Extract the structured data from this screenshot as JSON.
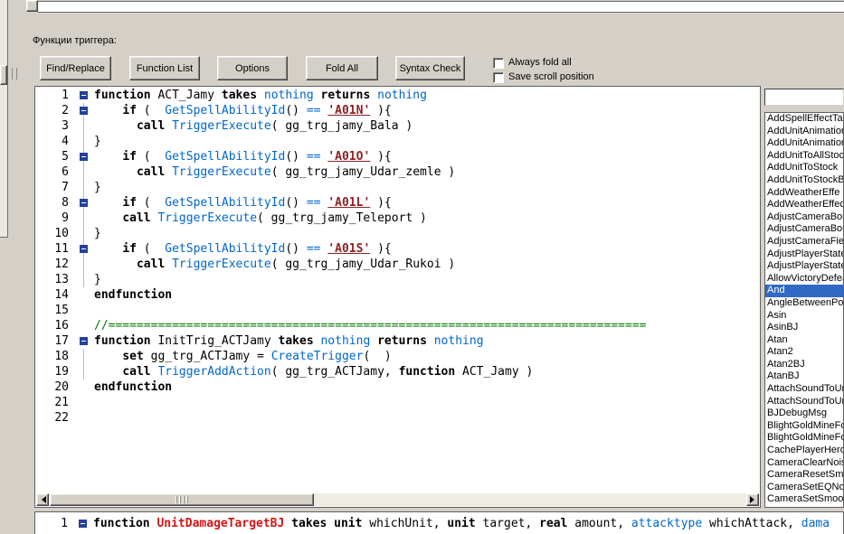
{
  "panel": {
    "label": "Функции триггера:"
  },
  "toolbar": {
    "buttons": [
      "Find/Replace",
      "Function List",
      "Options",
      "Fold All",
      "Syntax Check"
    ],
    "checkboxes": [
      {
        "label": "Always fold all",
        "checked": false
      },
      {
        "label": "Save scroll position",
        "checked": false
      }
    ]
  },
  "colors": {
    "window_bg": "#d4d0c8",
    "selection": "#316ac5",
    "keyword": "#000000",
    "native_blue": "#0066cc",
    "rawcode_red": "#8b2323",
    "comment_green": "#007800",
    "function_name_red": "#d41414",
    "fold_marker_blue": "#24409a"
  },
  "editor": {
    "lines": [
      {
        "num": "1",
        "fold": true,
        "segs": [
          [
            "k",
            "function "
          ],
          [
            "p",
            "ACT_Jamy "
          ],
          [
            "k",
            "takes "
          ],
          [
            "t",
            "nothing "
          ],
          [
            "k",
            "returns "
          ],
          [
            "t",
            "nothing"
          ]
        ]
      },
      {
        "num": "2",
        "fold": true,
        "fl": true,
        "segs": [
          [
            "p",
            "    "
          ],
          [
            "k",
            "if "
          ],
          [
            "p",
            "(  "
          ],
          [
            "n",
            "GetSpellAbilityId"
          ],
          [
            "p",
            "() "
          ],
          [
            "n",
            "== "
          ],
          [
            "r",
            "'A01N'"
          ],
          [
            "p",
            " ){"
          ]
        ]
      },
      {
        "num": "3",
        "fl": true,
        "segs": [
          [
            "p",
            "      "
          ],
          [
            "k",
            "call "
          ],
          [
            "n",
            "TriggerExecute"
          ],
          [
            "p",
            "( gg_trg_jamy_Bala )"
          ]
        ]
      },
      {
        "num": "4",
        "fl": true,
        "segs": [
          [
            "p",
            "}"
          ]
        ]
      },
      {
        "num": "5",
        "fold": true,
        "fl": true,
        "segs": [
          [
            "p",
            "    "
          ],
          [
            "k",
            "if "
          ],
          [
            "p",
            "(  "
          ],
          [
            "n",
            "GetSpellAbilityId"
          ],
          [
            "p",
            "() "
          ],
          [
            "n",
            "== "
          ],
          [
            "r",
            "'A01O'"
          ],
          [
            "p",
            " ){"
          ]
        ]
      },
      {
        "num": "6",
        "fl": true,
        "segs": [
          [
            "p",
            "      "
          ],
          [
            "k",
            "call "
          ],
          [
            "n",
            "TriggerExecute"
          ],
          [
            "p",
            "( gg_trg_jamy_Udar_zemle )"
          ]
        ]
      },
      {
        "num": "7",
        "fl": true,
        "segs": [
          [
            "p",
            "}"
          ]
        ]
      },
      {
        "num": "8",
        "fold": true,
        "fl": true,
        "segs": [
          [
            "p",
            "    "
          ],
          [
            "k",
            "if "
          ],
          [
            "p",
            "(  "
          ],
          [
            "n",
            "GetSpellAbilityId"
          ],
          [
            "p",
            "() "
          ],
          [
            "n",
            "== "
          ],
          [
            "r",
            "'A01L'"
          ],
          [
            "p",
            " ){"
          ]
        ]
      },
      {
        "num": "9",
        "fl": true,
        "segs": [
          [
            "p",
            "    "
          ],
          [
            "k",
            "call "
          ],
          [
            "n",
            "TriggerExecute"
          ],
          [
            "p",
            "( gg_trg_jamy_Teleport )"
          ]
        ]
      },
      {
        "num": "10",
        "fl": true,
        "segs": [
          [
            "p",
            "}"
          ]
        ]
      },
      {
        "num": "11",
        "fold": true,
        "fl": true,
        "segs": [
          [
            "p",
            "    "
          ],
          [
            "k",
            "if "
          ],
          [
            "p",
            "(  "
          ],
          [
            "n",
            "GetSpellAbilityId"
          ],
          [
            "p",
            "() "
          ],
          [
            "n",
            "== "
          ],
          [
            "r",
            "'A01S'"
          ],
          [
            "p",
            " ){"
          ]
        ]
      },
      {
        "num": "12",
        "fl": true,
        "segs": [
          [
            "p",
            "      "
          ],
          [
            "k",
            "call "
          ],
          [
            "n",
            "TriggerExecute"
          ],
          [
            "p",
            "( gg_trg_jamy_Udar_Rukoi )"
          ]
        ]
      },
      {
        "num": "13",
        "fl": true,
        "segs": [
          [
            "p",
            "}"
          ]
        ]
      },
      {
        "num": "14",
        "segs": [
          [
            "k",
            "endfunction"
          ]
        ]
      },
      {
        "num": "15",
        "segs": []
      },
      {
        "num": "16",
        "segs": [
          [
            "c",
            "//============================================================================"
          ]
        ]
      },
      {
        "num": "17",
        "fold": true,
        "segs": [
          [
            "k",
            "function "
          ],
          [
            "p",
            "InitTrig_ACTJamy "
          ],
          [
            "k",
            "takes "
          ],
          [
            "t",
            "nothing "
          ],
          [
            "k",
            "returns "
          ],
          [
            "t",
            "nothing"
          ]
        ]
      },
      {
        "num": "18",
        "fl": true,
        "segs": [
          [
            "p",
            "    "
          ],
          [
            "k",
            "set "
          ],
          [
            "p",
            "gg_trg_ACTJamy = "
          ],
          [
            "n",
            "CreateTrigger"
          ],
          [
            "p",
            "(  )"
          ]
        ]
      },
      {
        "num": "19",
        "fl": true,
        "segs": [
          [
            "p",
            "    "
          ],
          [
            "k",
            "call "
          ],
          [
            "n",
            "TriggerAddAction"
          ],
          [
            "p",
            "( gg_trg_ACTJamy, "
          ],
          [
            "k",
            "function "
          ],
          [
            "p",
            "ACT_Jamy )"
          ]
        ]
      },
      {
        "num": "20",
        "segs": [
          [
            "k",
            "endfunction"
          ]
        ]
      },
      {
        "num": "21",
        "segs": []
      },
      {
        "num": "22",
        "segs": []
      }
    ]
  },
  "bottom_editor": {
    "lines": [
      {
        "num": "1",
        "fold": true,
        "segs": [
          [
            "k",
            "function "
          ],
          [
            "f",
            "UnitDamageTargetBJ"
          ],
          [
            "k",
            " takes "
          ],
          [
            "k",
            "unit"
          ],
          [
            "p",
            " whichUnit, "
          ],
          [
            "k",
            "unit"
          ],
          [
            "p",
            " target, "
          ],
          [
            "k",
            "real"
          ],
          [
            "p",
            " amount, "
          ],
          [
            "t",
            "attacktype"
          ],
          [
            "p",
            " whichAttack, "
          ],
          [
            "t",
            "dama"
          ]
        ]
      }
    ]
  },
  "sidebar": {
    "search_value": "",
    "selected_index": 14,
    "selected_item": "And",
    "items": [
      "AddSpellEffectTar",
      "AddUnitAnimatior",
      "AddUnitAnimatior",
      "AddUnitToAllStoc",
      "AddUnitToStock",
      "AddUnitToStockB",
      "AddWeatherEffe",
      "AddWeatherEffec",
      "AdjustCameraBou",
      "AdjustCameraBou",
      "AdjustCameraFiel",
      "AdjustPlayerState",
      "AdjustPlayerState",
      "AllowVictoryDefea",
      "And",
      "AngleBetweenPoi",
      "Asin",
      "AsinBJ",
      "Atan",
      "Atan2",
      "Atan2BJ",
      "AtanBJ",
      "AttachSoundToUr",
      "AttachSoundToUr",
      "BJDebugMsg",
      "BlightGoldMineFor",
      "BlightGoldMineFor",
      "CachePlayerHero",
      "CameraClearNois",
      "CameraResetSmo",
      "CameraSetEQNois",
      "CameraSetSmoot"
    ]
  }
}
